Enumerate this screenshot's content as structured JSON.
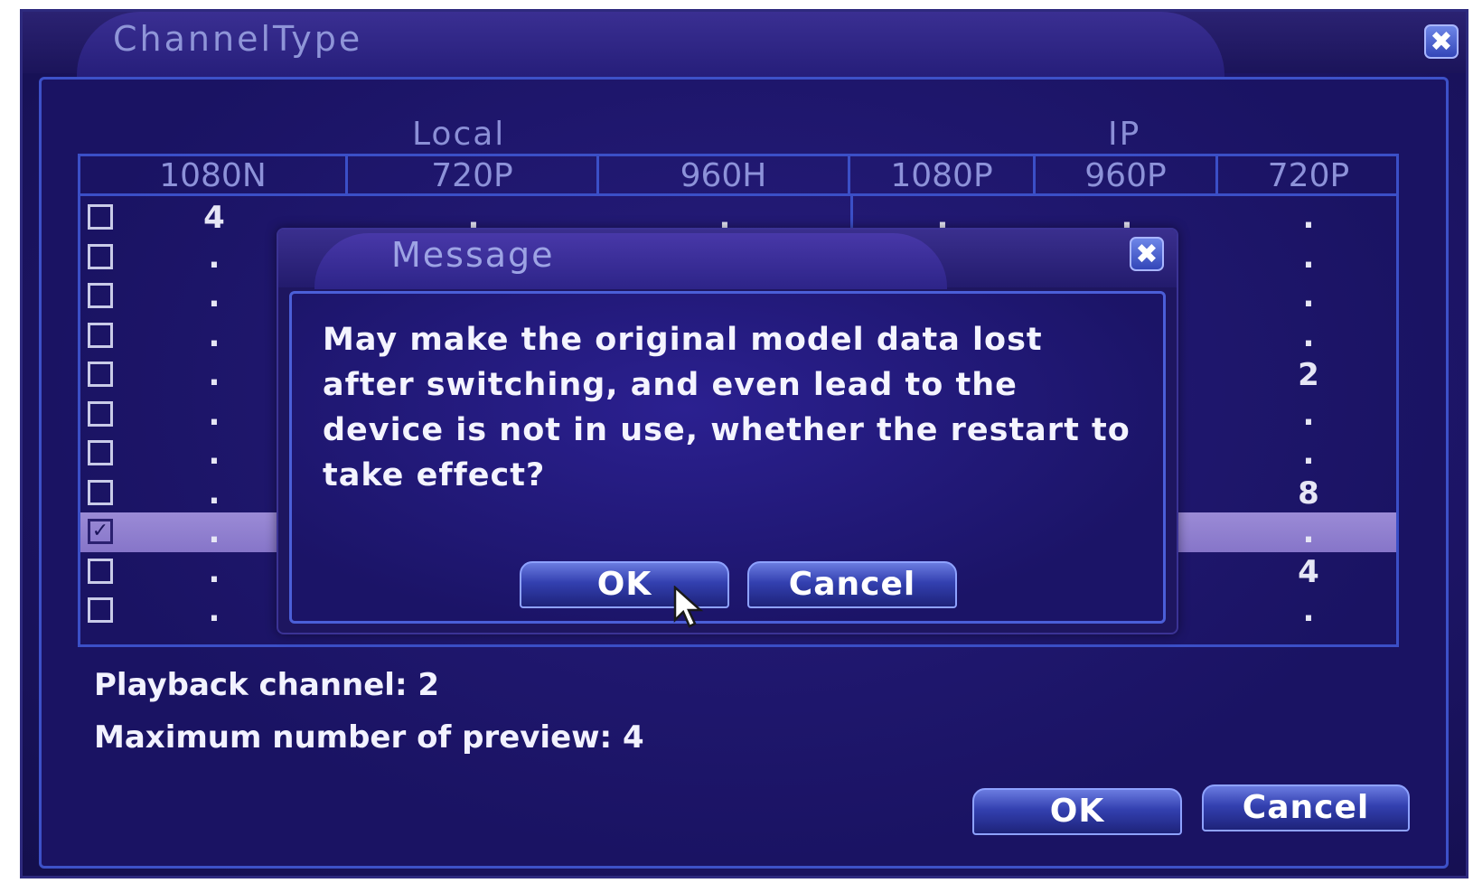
{
  "window": {
    "title": "ChannelType",
    "close_glyph": "✖"
  },
  "groups": {
    "local": "Local",
    "ip": "IP"
  },
  "columns": [
    "1080N",
    "720P",
    "960H",
    "1080P",
    "960P",
    "720P"
  ],
  "rows": [
    {
      "checked": false,
      "c1080n": "4",
      "c720p": ".",
      "c960h": ".",
      "ip1080p": ".",
      "ip960p": ".",
      "ip720p": "."
    },
    {
      "checked": false,
      "c1080n": ".",
      "c720p": "",
      "c960h": "",
      "ip1080p": "",
      "ip960p": "",
      "ip720p": "."
    },
    {
      "checked": false,
      "c1080n": ".",
      "c720p": "",
      "c960h": "",
      "ip1080p": "",
      "ip960p": "",
      "ip720p": "."
    },
    {
      "checked": false,
      "c1080n": ".",
      "c720p": "",
      "c960h": "",
      "ip1080p": "",
      "ip960p": "",
      "ip720p": "."
    },
    {
      "checked": false,
      "c1080n": ".",
      "c720p": "",
      "c960h": "",
      "ip1080p": "",
      "ip960p": "",
      "ip720p": "2"
    },
    {
      "checked": false,
      "c1080n": ".",
      "c720p": "",
      "c960h": "",
      "ip1080p": "",
      "ip960p": "",
      "ip720p": "."
    },
    {
      "checked": false,
      "c1080n": ".",
      "c720p": "",
      "c960h": "",
      "ip1080p": "",
      "ip960p": "",
      "ip720p": "."
    },
    {
      "checked": false,
      "c1080n": ".",
      "c720p": "",
      "c960h": "",
      "ip1080p": "",
      "ip960p": "",
      "ip720p": "8"
    },
    {
      "checked": true,
      "c1080n": ".",
      "c720p": "",
      "c960h": "",
      "ip1080p": "",
      "ip960p": "",
      "ip720p": "."
    },
    {
      "checked": false,
      "c1080n": ".",
      "c720p": "",
      "c960h": "",
      "ip1080p": "",
      "ip960p": "",
      "ip720p": "4"
    },
    {
      "checked": false,
      "c1080n": ".",
      "c720p": "",
      "c960h": "",
      "ip1080p": "",
      "ip960p": "",
      "ip720p": "."
    }
  ],
  "info": {
    "playback": "Playback channel: 2",
    "preview": "Maximum number of preview: 4"
  },
  "buttons": {
    "ok": "OK",
    "cancel": "Cancel"
  },
  "message": {
    "title": "Message",
    "close_glyph": "✖",
    "text": "May make the original model data lost\nafter switching, and even lead to the\ndevice is not in use, whether the restart to\ntake effect?",
    "ok": "OK",
    "cancel": "Cancel"
  },
  "colors": {
    "background": "#1d1568",
    "border": "#3b4fc7",
    "selected_row": "#8f7fd0",
    "button": "#3340b0",
    "text": "#f2f2ff"
  },
  "icons": {
    "close": "close-icon",
    "checkbox": "checkbox-icon",
    "cursor": "mouse-pointer-icon"
  }
}
